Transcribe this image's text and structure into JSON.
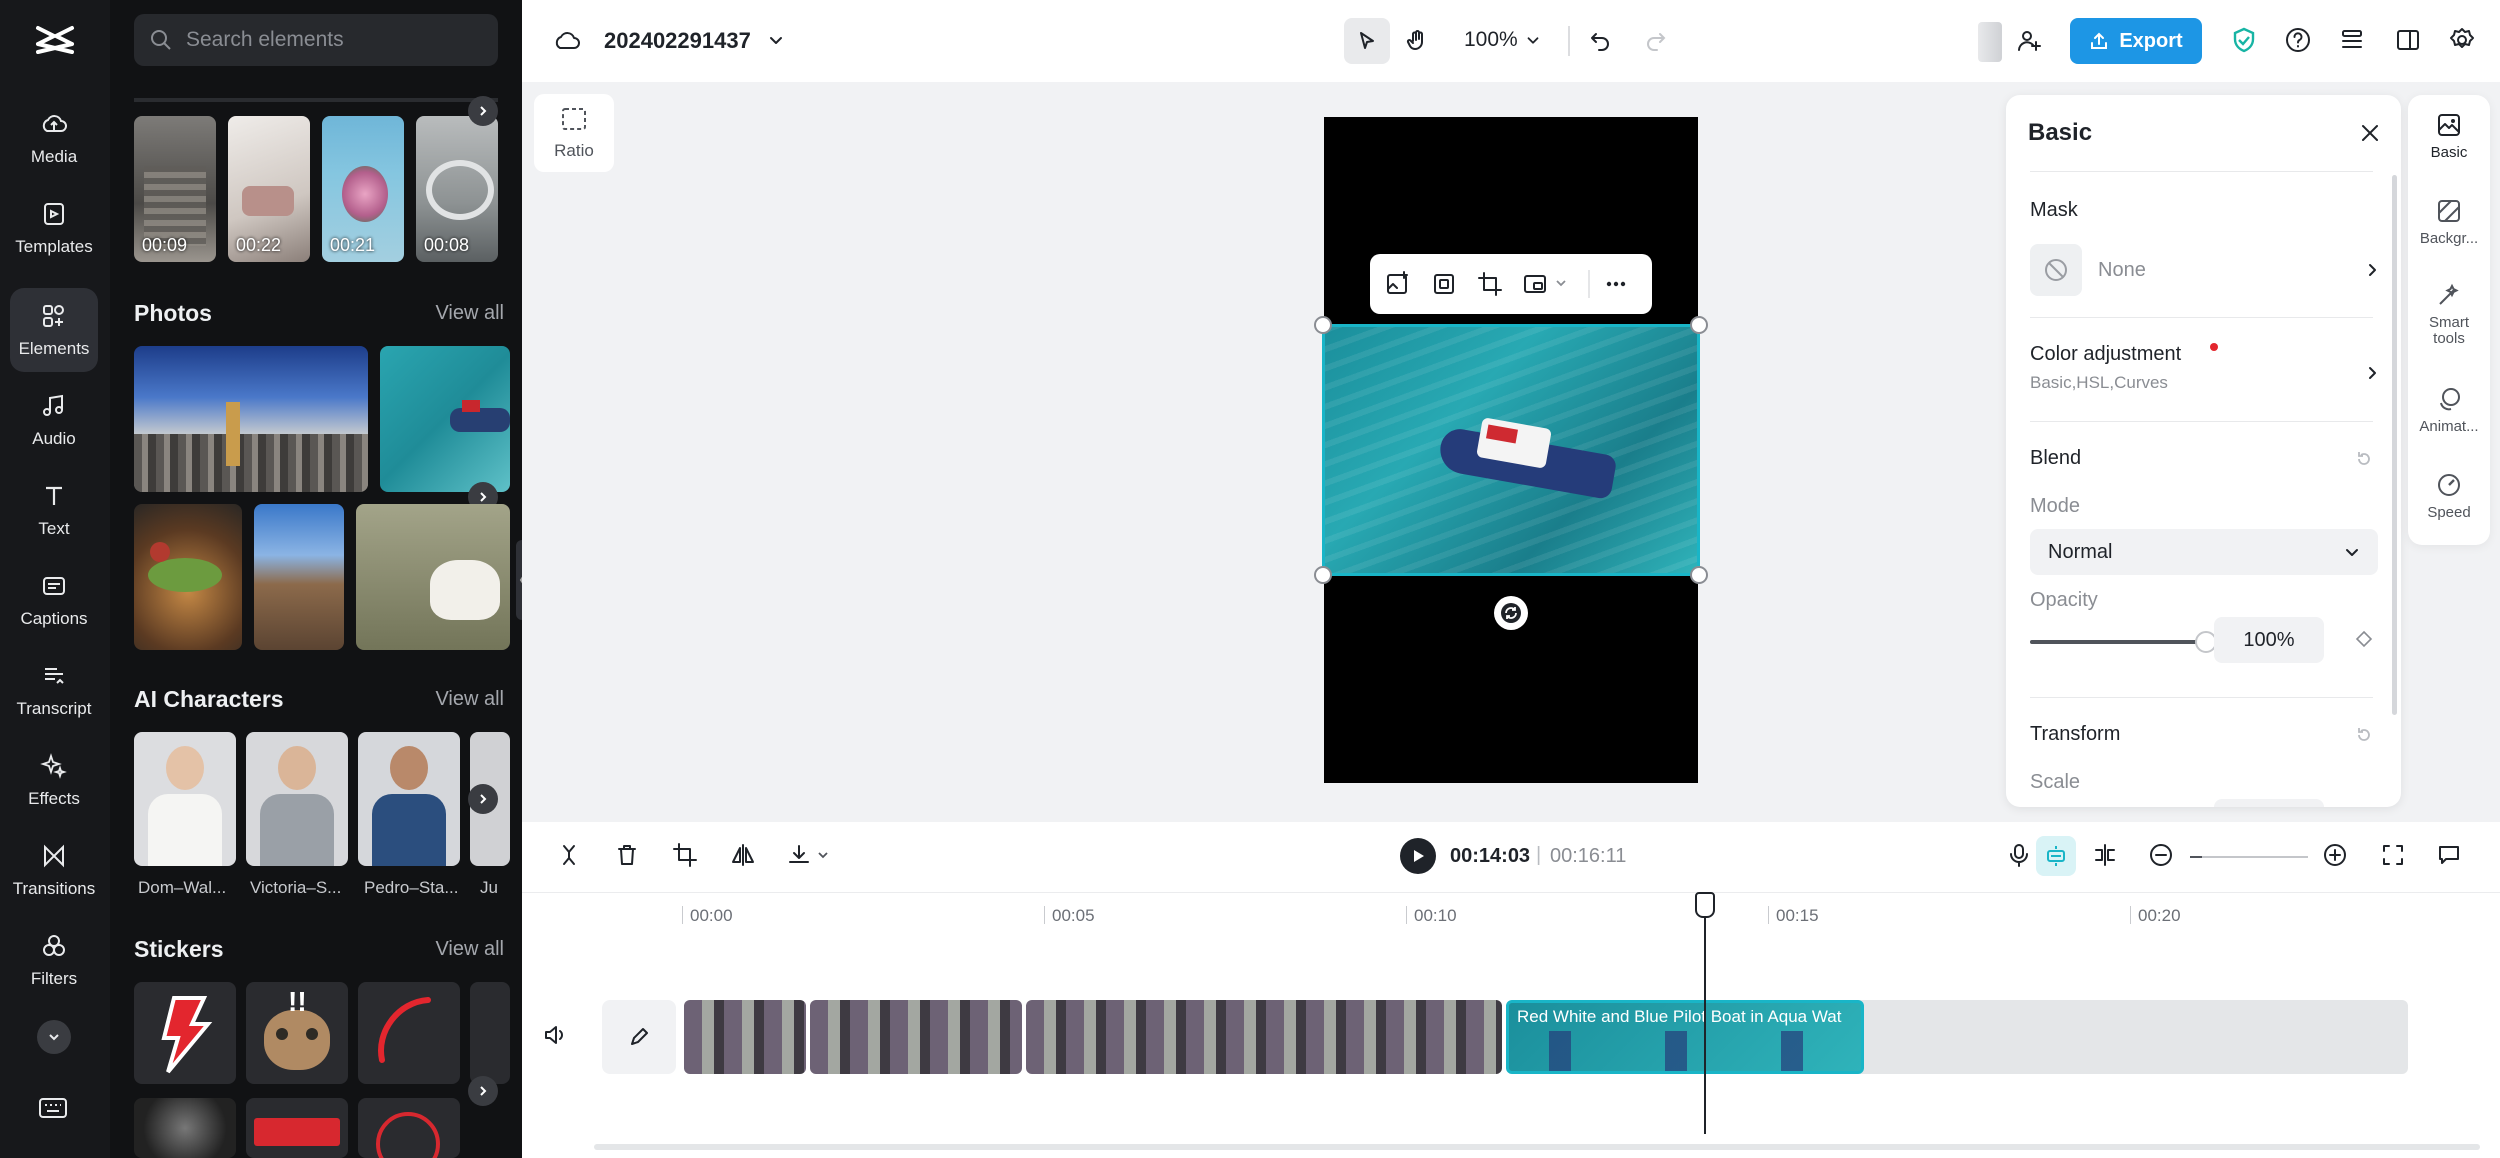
{
  "rail": {
    "items": [
      {
        "label": "Media",
        "icon": "cloud-upload-icon"
      },
      {
        "label": "Templates",
        "icon": "templates-icon"
      },
      {
        "label": "Elements",
        "icon": "elements-icon",
        "active": true
      },
      {
        "label": "Audio",
        "icon": "music-note-icon"
      },
      {
        "label": "Text",
        "icon": "text-icon"
      },
      {
        "label": "Captions",
        "icon": "captions-icon"
      },
      {
        "label": "Transcript",
        "icon": "transcript-icon"
      },
      {
        "label": "Effects",
        "icon": "sparkle-icon"
      },
      {
        "label": "Transitions",
        "icon": "transitions-icon"
      },
      {
        "label": "Filters",
        "icon": "filters-icon"
      }
    ]
  },
  "panel": {
    "search_placeholder": "Search elements",
    "videos": [
      {
        "duration": "00:09"
      },
      {
        "duration": "00:22"
      },
      {
        "duration": "00:21"
      },
      {
        "duration": "00:08"
      }
    ],
    "photos_title": "Photos",
    "ai_title": "AI Characters",
    "stickers_title": "Stickers",
    "view_all": "View all",
    "characters": [
      {
        "name": "Dom–Wal..."
      },
      {
        "name": "Victoria–S..."
      },
      {
        "name": "Pedro–Sta..."
      },
      {
        "name": "Ju"
      }
    ]
  },
  "topbar": {
    "project_name": "202402291437",
    "zoom": "100%",
    "export_label": "Export"
  },
  "canvas": {
    "ratio_label": "Ratio"
  },
  "inspector": {
    "title": "Basic",
    "mask_label": "Mask",
    "mask_value": "None",
    "color_adj_label": "Color adjustment",
    "color_adj_sub": "Basic,HSL,Curves",
    "blend_label": "Blend",
    "mode_label": "Mode",
    "mode_value": "Normal",
    "opacity_label": "Opacity",
    "opacity_value": "100%",
    "opacity_level": 1.0,
    "transform_label": "Transform",
    "scale_label": "Scale"
  },
  "right_tabs": [
    {
      "label": "Basic",
      "icon": "basic-icon"
    },
    {
      "label": "Backgr...",
      "icon": "background-icon"
    },
    {
      "label": "Smart tools",
      "icon": "magic-wand-icon"
    },
    {
      "label": "Animat...",
      "icon": "animation-icon"
    },
    {
      "label": "Speed",
      "icon": "speed-icon"
    }
  ],
  "timeline": {
    "current_time": "00:14:03",
    "total_time": "00:16:11",
    "ticks": [
      "00:00",
      "00:05",
      "00:10",
      "00:15",
      "00:20"
    ],
    "clip_title": "Red White and Blue Pilot Boat in Aqua Wat"
  },
  "colors": {
    "accent": "#1d96e5",
    "clip_selected": "#19b5c7",
    "rail_bg": "#17181b",
    "panel_bg": "#111214"
  }
}
